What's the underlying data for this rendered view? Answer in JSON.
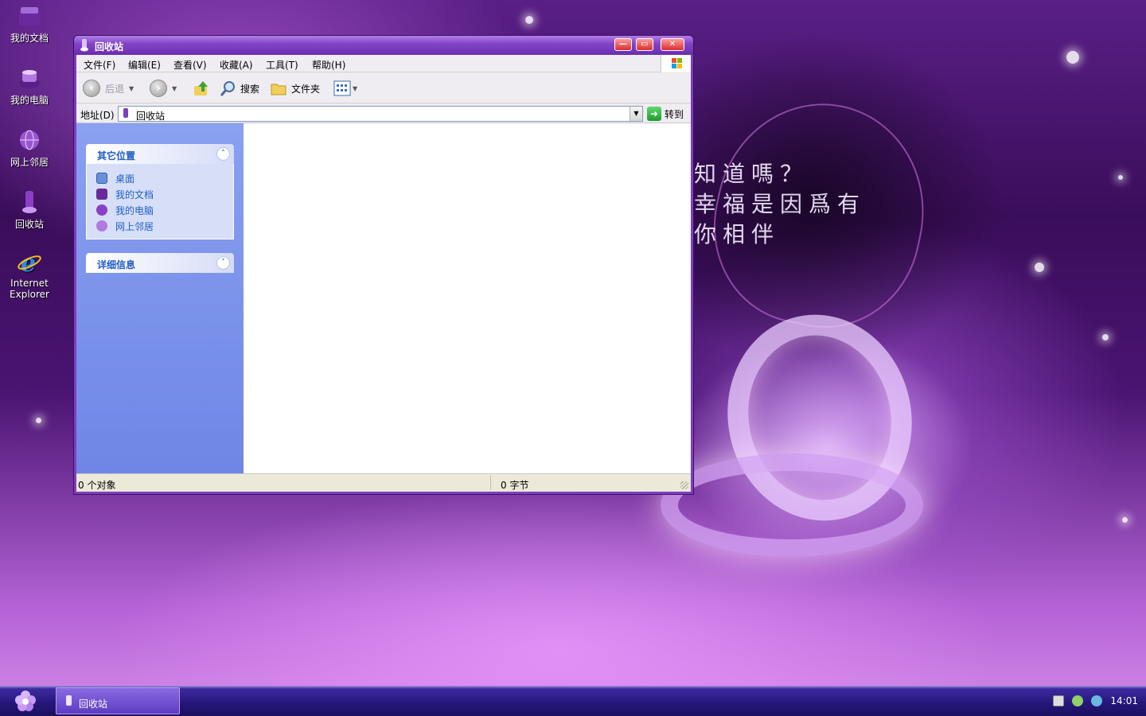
{
  "desktop": {
    "icons": [
      {
        "label": "我的文档"
      },
      {
        "label": "我的电脑"
      },
      {
        "label": "网上邻居"
      },
      {
        "label": "回收站"
      },
      {
        "label_line1": "Internet",
        "label_line2": "Explorer"
      }
    ],
    "wallpaper_text": [
      "知道嗎？",
      "幸福是因爲有",
      "你相伴"
    ]
  },
  "window": {
    "title": "回收站",
    "buttons": {
      "minimize": "—",
      "maximize": "▭",
      "close": "✕"
    },
    "menu": [
      "文件(F)",
      "编辑(E)",
      "查看(V)",
      "收藏(A)",
      "工具(T)",
      "帮助(H)"
    ],
    "toolbar": {
      "back": "后退",
      "search": "搜索",
      "folders": "文件夹"
    },
    "address": {
      "label": "地址(D)",
      "value": "回收站",
      "go": "转到"
    },
    "sidebar": {
      "other_places": {
        "title": "其它位置",
        "items": [
          "桌面",
          "我的文档",
          "我的电脑",
          "网上邻居"
        ]
      },
      "details": {
        "title": "详细信息"
      }
    },
    "status": {
      "objects": "0 个对象",
      "bytes": "0 字节"
    }
  },
  "taskbar": {
    "task": "回收站",
    "clock": "14:01"
  },
  "colors": {
    "accent": "#7e3fbf",
    "link": "#215dc6",
    "sidebar": "#7088e6"
  }
}
